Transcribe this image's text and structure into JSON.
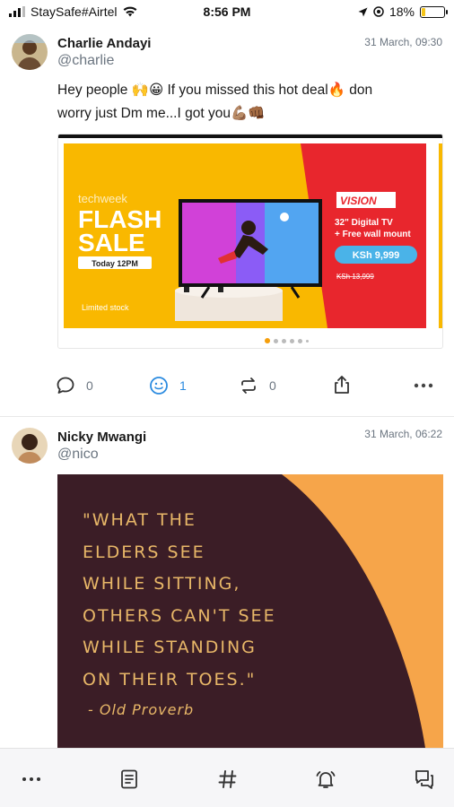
{
  "status_bar": {
    "carrier": "StaySafe#Airtel",
    "time": "8:56 PM",
    "battery": "18%",
    "battery_level": 0.18
  },
  "posts": [
    {
      "name": "Charlie Andayi",
      "handle": "@charlie",
      "date": "31 March, 09:30",
      "text_1": "Hey people 🙌😀 If you missed this hot deal🔥 don",
      "text_2": "worry just Dm me...I got you💪🏽👊🏾",
      "banner": {
        "brand_small": "techweek",
        "headline_1": "FLASH",
        "headline_2": "SALE",
        "when": "Today 12PM",
        "stock": "Limited stock",
        "vision": "VISION",
        "product_1": "32\" Digital TV",
        "product_2": "+ Free wall mount",
        "price": "KSh 9,999",
        "old_price": "KSh 13,999"
      },
      "comments": "0",
      "reactions": "1",
      "reposts": "0"
    },
    {
      "name": "Nicky Mwangi",
      "handle": "@nico",
      "date": "31 March, 06:22",
      "quote_lines": [
        "\"WHAT THE",
        "ELDERS SEE",
        "WHILE SITTING,",
        "OTHERS CAN'T SEE",
        "WHILE STANDING",
        "ON THEIR TOES.\""
      ],
      "quote_author": "- Old Proverb"
    }
  ],
  "colors": {
    "accent": "#2b8be0",
    "muted": "#6b7580",
    "banner_yellow": "#f9b800",
    "banner_red": "#e8262d"
  }
}
